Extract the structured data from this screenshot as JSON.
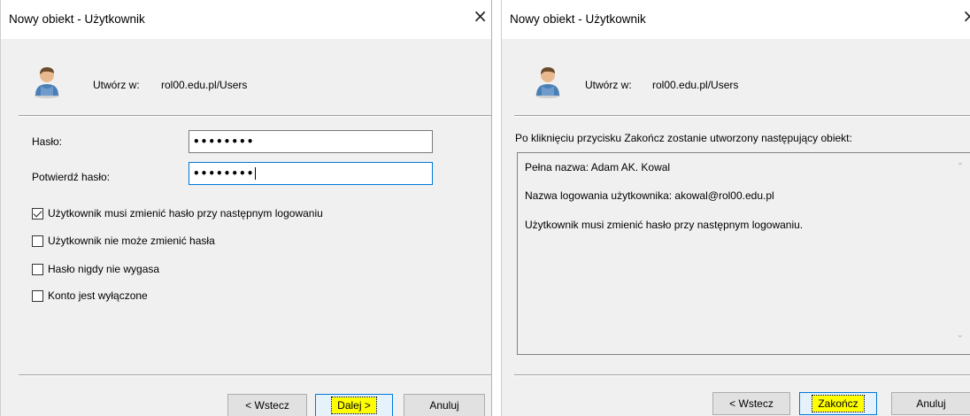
{
  "left_dialog": {
    "title": "Nowy obiekt - Użytkownik",
    "close_glyph": "×",
    "create_in_label": "Utwórz w:",
    "create_in_value": "rol00.edu.pl/Users",
    "password_label": "Hasło:",
    "password_value": "••••••••",
    "confirm_label": "Potwierdź hasło:",
    "confirm_value": "••••••••",
    "checkboxes": [
      {
        "label": "Użytkownik musi zmienić hasło przy następnym logowaniu",
        "checked": true
      },
      {
        "label": "Użytkownik nie może zmienić hasła",
        "checked": false
      },
      {
        "label": "Hasło nigdy nie wygasa",
        "checked": false
      },
      {
        "label": "Konto jest wyłączone",
        "checked": false
      }
    ],
    "back_label": "< Wstecz",
    "next_label": "Dalej >",
    "cancel_label": "Anuluj"
  },
  "right_dialog": {
    "title": "Nowy obiekt - Użytkownik",
    "close_glyph": "×",
    "create_in_label": "Utwórz w:",
    "create_in_value": "rol00.edu.pl/Users",
    "info_text": "Po kliknięciu przycisku Zakończ zostanie utworzony następujący obiekt:",
    "summary_lines": [
      "Pełna nazwa: Adam AK. Kowal",
      "Nazwa logowania użytkownika: akowal@rol00.edu.pl",
      "Użytkownik musi zmienić hasło przy następnym logowaniu."
    ],
    "back_label": "< Wstecz",
    "finish_label": "Zakończ",
    "cancel_label": "Anuluj"
  },
  "icons": {
    "user": "user-icon",
    "close": "close-icon",
    "scroll_up": "chevron-up-icon",
    "scroll_down": "chevron-down-icon"
  },
  "colors": {
    "dialog_bg": "#f0f0f0",
    "focus_border": "#0078d7",
    "highlight": "#ffff00"
  }
}
